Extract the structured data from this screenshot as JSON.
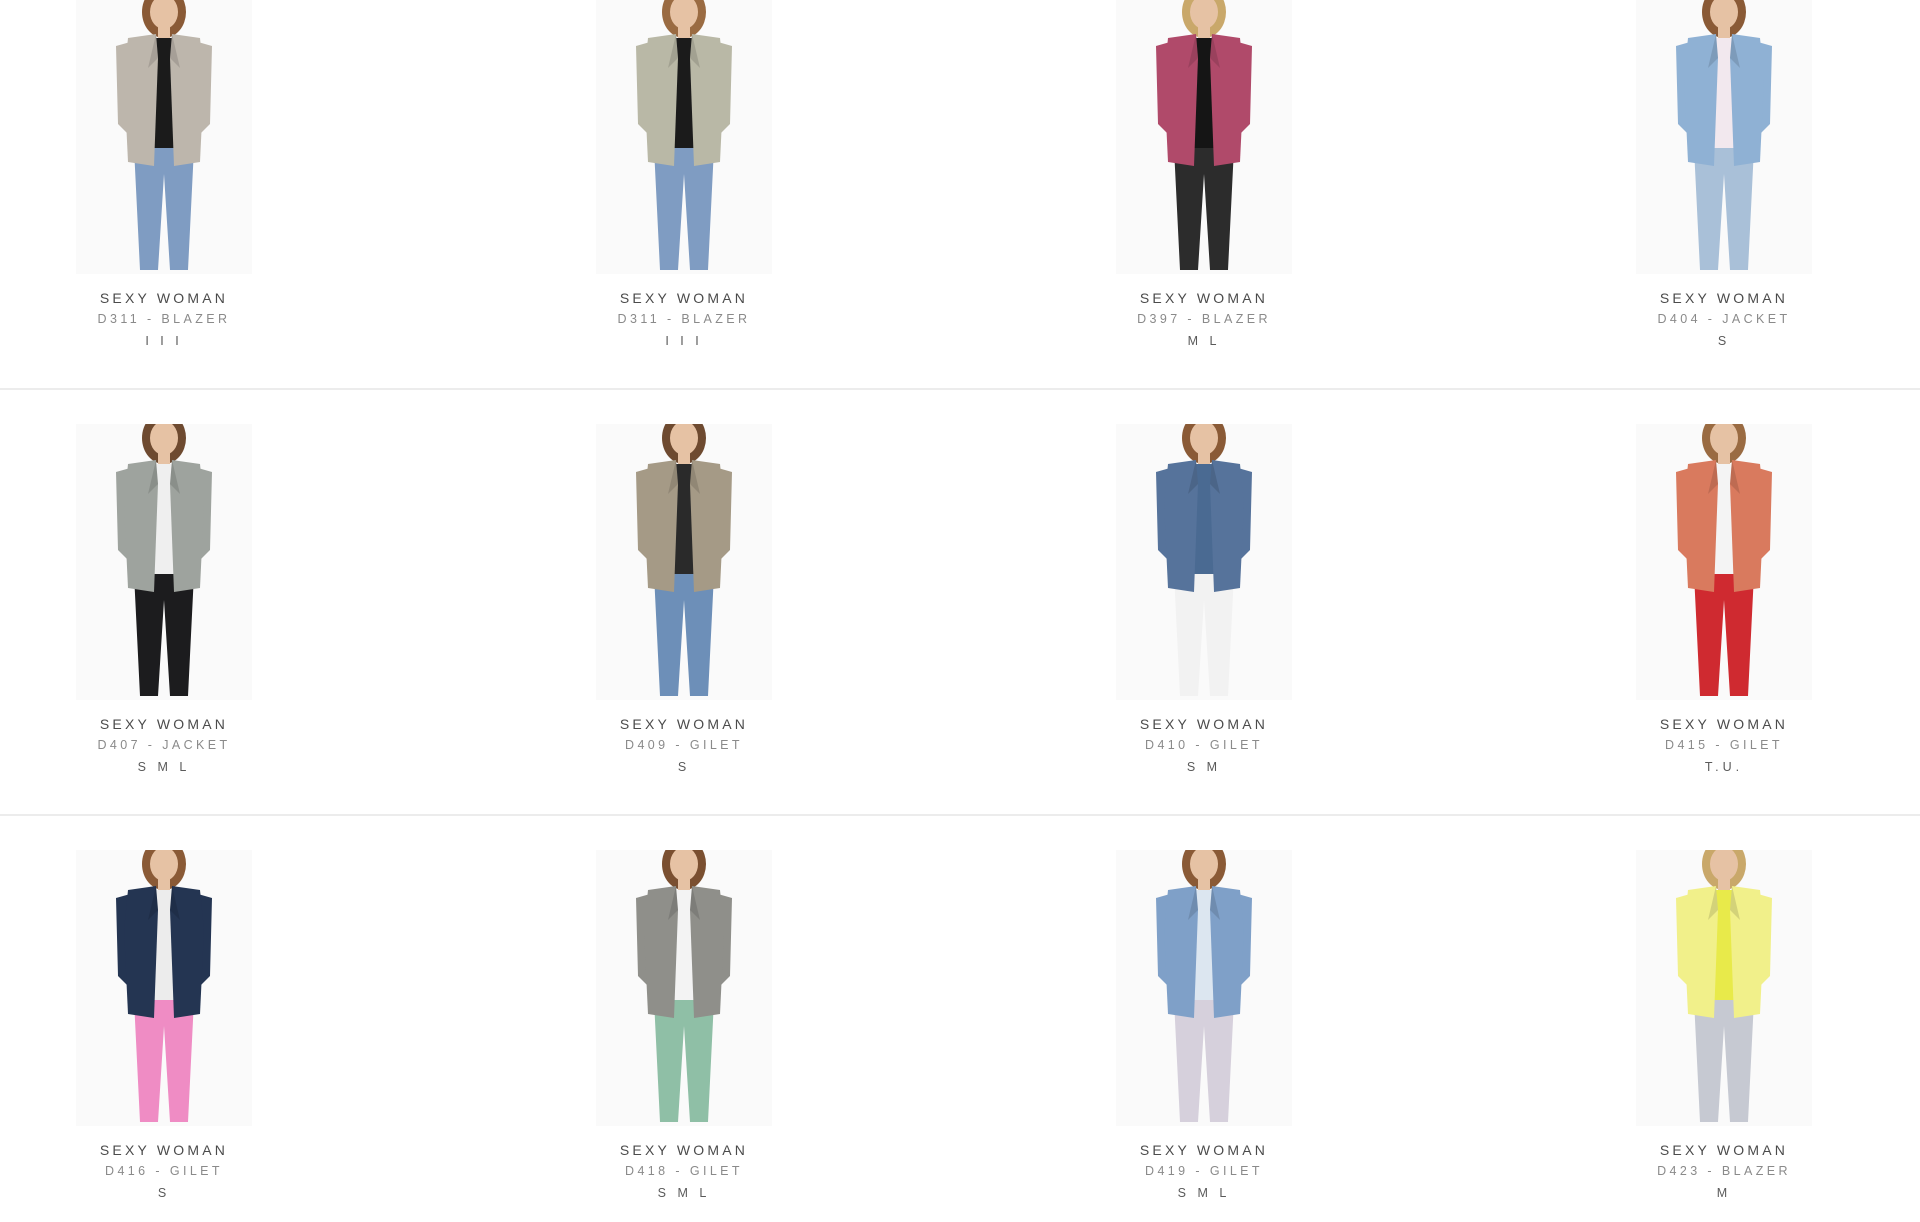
{
  "products": [
    {
      "brand": "SEXY WOMAN",
      "model": "D311 - BLAZER",
      "sizes": "I I I",
      "colors": {
        "top": "#bdb6ac",
        "inner": "#1b1b1b",
        "bottom": "#7f9cc2",
        "skin": "#e6c2a4",
        "hair": "#8a5a36"
      }
    },
    {
      "brand": "SEXY WOMAN",
      "model": "D311 - BLAZER",
      "sizes": "I I I",
      "colors": {
        "top": "#b9b8a6",
        "inner": "#1b1b1b",
        "bottom": "#7f9cc2",
        "skin": "#e6c2a4",
        "hair": "#9a6b42"
      }
    },
    {
      "brand": "SEXY WOMAN",
      "model": "D397 - BLAZER",
      "sizes": "M L",
      "colors": {
        "top": "#b04a6a",
        "inner": "#151515",
        "bottom": "#2c2c2c",
        "skin": "#e6c2a4",
        "hair": "#c9a86a"
      }
    },
    {
      "brand": "SEXY WOMAN",
      "model": "D404 - JACKET",
      "sizes": "S",
      "colors": {
        "top": "#8fb1d4",
        "inner": "#f2e8ee",
        "bottom": "#a9c0d8",
        "skin": "#e6c2a4",
        "hair": "#8a5a36"
      }
    },
    {
      "brand": "SEXY WOMAN",
      "model": "D407 - JACKET",
      "sizes": "S M L",
      "colors": {
        "top": "#9ea39e",
        "inner": "#efefef",
        "bottom": "#1c1c1e",
        "skin": "#e6c2a4",
        "hair": "#6e4a30"
      }
    },
    {
      "brand": "SEXY WOMAN",
      "model": "D409 - GILET",
      "sizes": "S",
      "colors": {
        "top": "#a59a86",
        "inner": "#2a2a2a",
        "bottom": "#6d8fb8",
        "skin": "#e6c2a4",
        "hair": "#6e4a30"
      }
    },
    {
      "brand": "SEXY WOMAN",
      "model": "D410 - GILET",
      "sizes": "S M",
      "colors": {
        "top": "#56739b",
        "inner": "#4a6a92",
        "bottom": "#f2f2f2",
        "skin": "#e6c2a4",
        "hair": "#8a5a36"
      }
    },
    {
      "brand": "SEXY WOMAN",
      "model": "D415 - GILET",
      "sizes": "T.U.",
      "colors": {
        "top": "#d97a5e",
        "inner": "#f4f4f4",
        "bottom": "#cf2a30",
        "skin": "#e6c2a4",
        "hair": "#9a6b42"
      }
    },
    {
      "brand": "SEXY WOMAN",
      "model": "D416 - GILET",
      "sizes": "S",
      "colors": {
        "top": "#243552",
        "inner": "#ececec",
        "bottom": "#ef8cc4",
        "skin": "#e6c2a4",
        "hair": "#8a5a36"
      }
    },
    {
      "brand": "SEXY WOMAN",
      "model": "D418 - GILET",
      "sizes": "S M L",
      "colors": {
        "top": "#8f8f8a",
        "inner": "#f3f3f3",
        "bottom": "#8fbfa6",
        "skin": "#e6c2a4",
        "hair": "#7a4f30"
      }
    },
    {
      "brand": "SEXY WOMAN",
      "model": "D419 - GILET",
      "sizes": "S M L",
      "colors": {
        "top": "#7fa0c8",
        "inner": "#dce6f0",
        "bottom": "#d6d0dc",
        "skin": "#e6c2a4",
        "hair": "#8a5a36"
      }
    },
    {
      "brand": "SEXY WOMAN",
      "model": "D423 - BLAZER",
      "sizes": "M",
      "colors": {
        "top": "#f1f08a",
        "inner": "#e8ea4a",
        "bottom": "#c6c9d2",
        "skin": "#e6c2a4",
        "hair": "#c9a86a"
      }
    }
  ]
}
